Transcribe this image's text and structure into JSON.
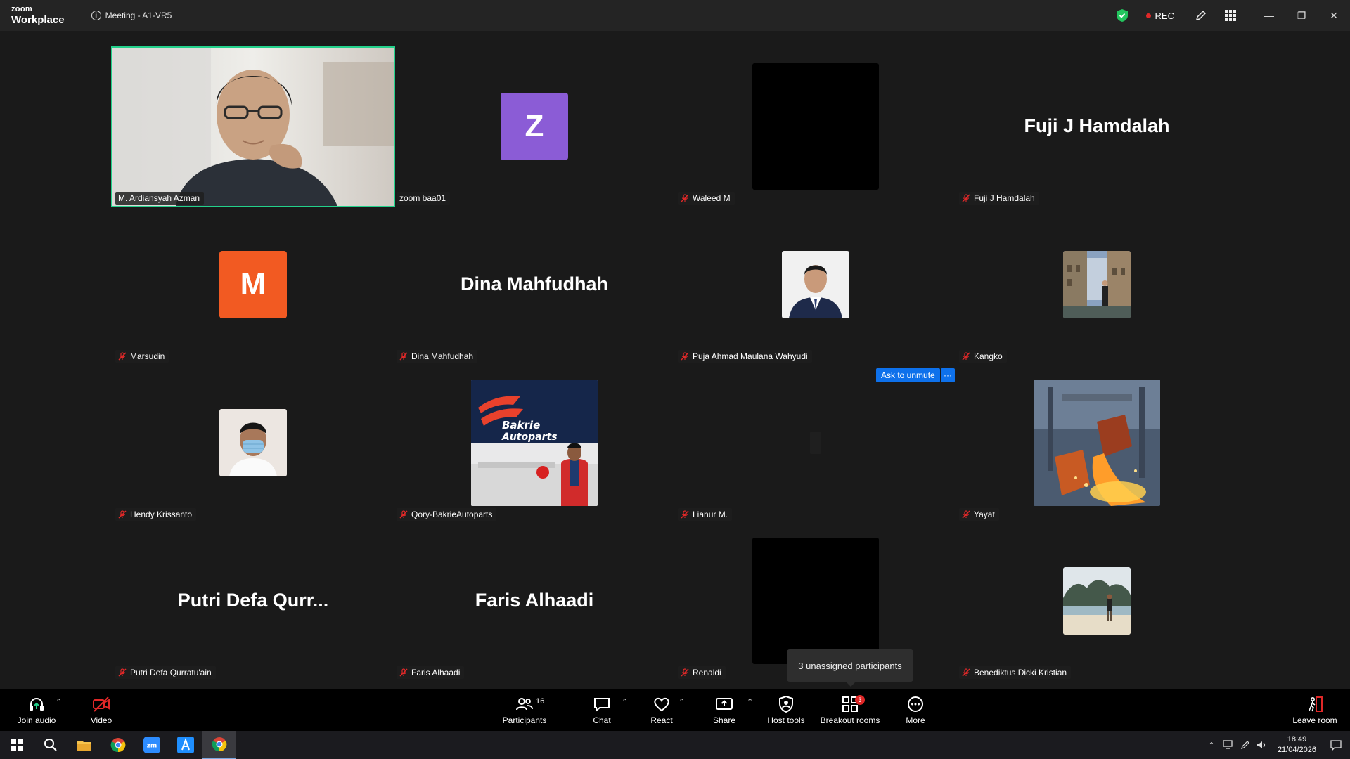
{
  "titlebar": {
    "brand_small": "zoom",
    "brand_big": "Workplace",
    "meeting_title": "Meeting - A1-VR5",
    "rec_label": "REC"
  },
  "tiles": [
    {
      "name": "M. Ardiansyah Azman",
      "muted": false,
      "type": "video",
      "active": true
    },
    {
      "name": "zoom baa01",
      "muted": false,
      "type": "letter",
      "letter": "Z",
      "color": "#8b5cd6"
    },
    {
      "name": "Waleed M",
      "muted": true,
      "type": "black"
    },
    {
      "name": "Fuji J Hamdalah",
      "muted": true,
      "type": "bigname",
      "display": "Fuji J Hamdalah"
    },
    {
      "name": "Marsudin",
      "muted": true,
      "type": "letter",
      "letter": "M",
      "color": "#f25a22"
    },
    {
      "name": "Dina Mahfudhah",
      "muted": true,
      "type": "bigname",
      "display": "Dina Mahfudhah"
    },
    {
      "name": "Puja Ahmad Maulana Wahyudi",
      "muted": true,
      "type": "pic-suit"
    },
    {
      "name": "Kangko",
      "muted": true,
      "type": "pic-city"
    },
    {
      "name": "Hendy Krissanto",
      "muted": true,
      "type": "pic-mask"
    },
    {
      "name": "Qory-BakrieAutoparts",
      "muted": true,
      "type": "pic-bakrie",
      "logo_text": "Bakrie Autoparts"
    },
    {
      "name": "Lianur M.",
      "muted": true,
      "type": "empty"
    },
    {
      "name": "Yayat",
      "muted": true,
      "type": "pic-steel"
    },
    {
      "name": "Putri Defa Qurratu'ain",
      "muted": true,
      "type": "bigname",
      "display": "Putri  Defa  Qurr..."
    },
    {
      "name": "Faris Alhaadi",
      "muted": true,
      "type": "bigname",
      "display": "Faris Alhaadi"
    },
    {
      "name": "Renaldi",
      "muted": true,
      "type": "black"
    },
    {
      "name": "Benediktus Dicki Kristian",
      "muted": true,
      "type": "pic-beach"
    }
  ],
  "overlays": {
    "ask_unmute": "Ask to unmute",
    "ask_more": "···",
    "tooltip": "3 unassigned participants"
  },
  "toolbar": {
    "join_audio": "Join audio",
    "video": "Video",
    "participants": "Participants",
    "participants_count": "16",
    "chat": "Chat",
    "react": "React",
    "share": "Share",
    "host_tools": "Host tools",
    "breakout_rooms": "Breakout rooms",
    "breakout_badge": "3",
    "more": "More",
    "leave_room": "Leave room"
  },
  "taskbar": {
    "time": "18:49",
    "date": "21/04/2026"
  },
  "colors": {
    "accent_blue": "#0e71eb",
    "active_speaker": "#23d18b",
    "mute_red": "#e02828"
  }
}
